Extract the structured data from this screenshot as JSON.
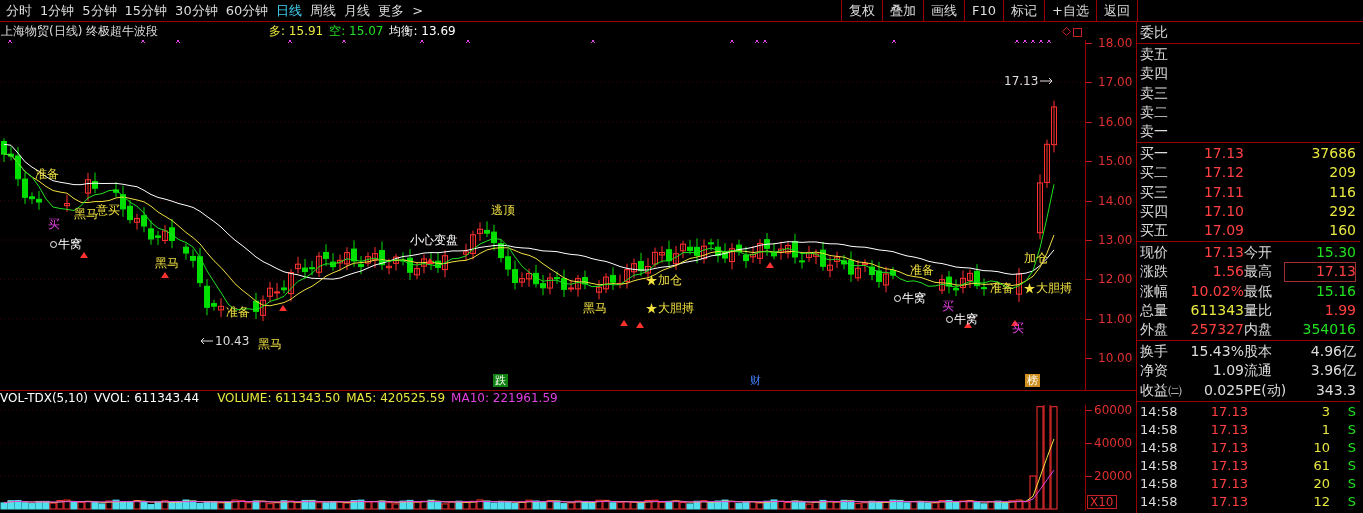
{
  "toolbar": {
    "periods": [
      {
        "label": "分时",
        "selected": false
      },
      {
        "label": "1分钟",
        "selected": false
      },
      {
        "label": "5分钟",
        "selected": false
      },
      {
        "label": "15分钟",
        "selected": false
      },
      {
        "label": "30分钟",
        "selected": false
      },
      {
        "label": "60分钟",
        "selected": false
      },
      {
        "label": "日线",
        "selected": true
      },
      {
        "label": "周线",
        "selected": false
      },
      {
        "label": "月线",
        "selected": false
      },
      {
        "label": "更多",
        "selected": false
      }
    ],
    "more_arrow": ">",
    "buttons": [
      "复权",
      "叠加",
      "画线",
      "F10",
      "标记",
      "+自选",
      "返回"
    ]
  },
  "chart": {
    "title": "上海物贸(日线) 终极超牛波段",
    "legend": [
      {
        "text": "多: 15.91",
        "color": "#e8e840"
      },
      {
        "text": "空: 15.07",
        "color": "#20e020"
      },
      {
        "text": "均衡: 13.69",
        "color": "#ffffff"
      }
    ],
    "annotations": [
      {
        "text": "17.13",
        "kind": "high_price"
      },
      {
        "text": "准备",
        "kind": "label"
      },
      {
        "text": "买",
        "kind": "buy"
      },
      {
        "text": "牛窝",
        "kind": "nest"
      },
      {
        "text": "黑马",
        "kind": "label"
      },
      {
        "text": "意买",
        "kind": "label"
      },
      {
        "text": "黑马",
        "kind": "label"
      },
      {
        "text": "准备",
        "kind": "label"
      },
      {
        "text": "10.43",
        "kind": "low_price"
      },
      {
        "text": "黑马",
        "kind": "label"
      },
      {
        "text": "小心变盘",
        "kind": "plain"
      },
      {
        "text": "逃顶",
        "kind": "label"
      },
      {
        "text": "黑马",
        "kind": "label"
      },
      {
        "text": "加仓",
        "kind": "star"
      },
      {
        "text": "大胆搏",
        "kind": "star"
      },
      {
        "text": "准备",
        "kind": "label"
      },
      {
        "text": "牛窝",
        "kind": "nest"
      },
      {
        "text": "买",
        "kind": "buy"
      },
      {
        "text": "牛窝",
        "kind": "nest"
      },
      {
        "text": "准备",
        "kind": "label"
      },
      {
        "text": "加仓",
        "kind": "label"
      },
      {
        "text": "大胆搏",
        "kind": "star"
      },
      {
        "text": "买",
        "kind": "buy"
      }
    ],
    "events": [
      {
        "text": "跌",
        "kind": "down"
      },
      {
        "text": "财",
        "kind": "finance"
      },
      {
        "text": "榜",
        "kind": "ranking"
      }
    ],
    "price_axis": [
      "18.00",
      "17.00",
      "16.00",
      "15.00",
      "14.00",
      "13.00",
      "12.00",
      "11.00",
      "10.00"
    ]
  },
  "volume": {
    "legend": [
      {
        "text": "VOL-TDX(5,10)",
        "color": "#ffffff"
      },
      {
        "text": "VVOL: 611343.44",
        "color": "#ffffff"
      },
      {
        "text": "VOLUME: 611343.50",
        "color": "#e8e840"
      },
      {
        "text": "MA5: 420525.59",
        "color": "#e8e840"
      },
      {
        "text": "MA10: 221961.59",
        "color": "#e040e0"
      }
    ],
    "axis": [
      "60000",
      "40000",
      "20000"
    ],
    "scale": "X10"
  },
  "quote": {
    "ratio_label": "委比",
    "asks": [
      "卖五",
      "卖四",
      "卖三",
      "卖二",
      "卖一"
    ],
    "bids": [
      {
        "label": "买一",
        "price": "17.13",
        "volume": "37686"
      },
      {
        "label": "买二",
        "price": "17.12",
        "volume": "209"
      },
      {
        "label": "买三",
        "price": "17.11",
        "volume": "116"
      },
      {
        "label": "买四",
        "price": "17.10",
        "volume": "292"
      },
      {
        "label": "买五",
        "price": "17.09",
        "volume": "160"
      }
    ],
    "stats": [
      {
        "label": "现价",
        "value": "17.13",
        "color": "#ff4040",
        "highlighted": false
      },
      {
        "label": "今开",
        "value": "15.30",
        "color": "#20e020",
        "highlighted": false
      },
      {
        "label": "涨跌",
        "value": "1.56",
        "color": "#ff4040",
        "highlighted": false
      },
      {
        "label": "最高",
        "value": "17.13",
        "color": "#ff4040",
        "highlighted": true
      },
      {
        "label": "涨幅",
        "value": "10.02%",
        "color": "#ff4040",
        "highlighted": false
      },
      {
        "label": "最低",
        "value": "15.16",
        "color": "#20e020",
        "highlighted": false
      },
      {
        "label": "总量",
        "value": "611343",
        "color": "#e8e840",
        "highlighted": false
      },
      {
        "label": "量比",
        "value": "1.99",
        "color": "#ff4040",
        "highlighted": false
      },
      {
        "label": "外盘",
        "value": "257327",
        "color": "#ff4040",
        "highlighted": false
      },
      {
        "label": "内盘",
        "value": "354016",
        "color": "#20e020",
        "highlighted": false
      }
    ],
    "fundamentals": [
      {
        "label": "换手",
        "value": "15.43%"
      },
      {
        "label": "股本",
        "value": "4.96亿"
      },
      {
        "label": "净资",
        "value": "1.09"
      },
      {
        "label": "流通",
        "value": "3.96亿"
      },
      {
        "label": "收益㈡",
        "value": "0.025"
      },
      {
        "label": "PE(动)",
        "value": "343.3"
      }
    ],
    "trades": [
      {
        "time": "14:58",
        "price": "17.13",
        "volume": "3",
        "side": "S"
      },
      {
        "time": "14:58",
        "price": "17.13",
        "volume": "1",
        "side": "S"
      },
      {
        "time": "14:58",
        "price": "17.13",
        "volume": "10",
        "side": "S"
      },
      {
        "time": "14:58",
        "price": "17.13",
        "volume": "61",
        "side": "S"
      },
      {
        "time": "14:58",
        "price": "17.13",
        "volume": "20",
        "side": "S"
      },
      {
        "time": "14:58",
        "price": "17.13",
        "volume": "12",
        "side": "S"
      }
    ]
  }
}
